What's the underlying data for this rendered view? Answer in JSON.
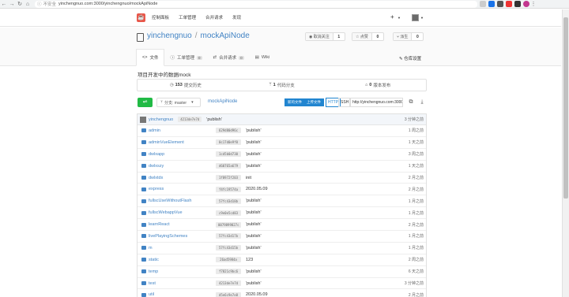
{
  "browser": {
    "insecure_label": "不安全",
    "url": "yinchengnuo.com:3000/yinchengnuo/mockApiNode"
  },
  "topnav": [
    "控制面板",
    "工单管理",
    "合并请求",
    "发现"
  ],
  "repo": {
    "owner": "yinchengnuo",
    "name": "mockApiNode",
    "watch_label": "取消关注",
    "watch_count": "1",
    "star_label": "点赞",
    "star_count": "0",
    "fork_label": "派生",
    "fork_count": "0"
  },
  "tabs": [
    {
      "label": "文件",
      "badge": ""
    },
    {
      "label": "工单管理",
      "badge": "0"
    },
    {
      "label": "合并请求",
      "badge": "0"
    },
    {
      "label": "Wiki",
      "badge": ""
    }
  ],
  "settings_label": "仓库设置",
  "description": "项目开发中的数据mock",
  "stats": {
    "commits_count": "153",
    "commits_label": "提交历史",
    "branches_count": "1",
    "branches_label": "代码分支",
    "releases_count": "0",
    "releases_label": "版本发布"
  },
  "toolbar": {
    "branch_label": "分支: master",
    "path": "mockApiNode",
    "new_file": "新的文件",
    "upload_file": "上传文件",
    "https": "HTTP",
    "ssh": "SSH",
    "clone_url": "http://yinchengnuo.com:3000/yinchengnuo/mockApiNode.git"
  },
  "latest_commit": {
    "author": "yinchengnuo",
    "sha": "4213de7e7d",
    "message": "'publish'",
    "time": "3 分钟之前"
  },
  "files": [
    {
      "name": "admin",
      "sha": "629d80d96c",
      "message": "'publish'",
      "time": "1 周之前"
    },
    {
      "name": "adminVueElement",
      "sha": "0c17d0e9f0",
      "message": "'publish'",
      "time": "1 天之前"
    },
    {
      "name": "dwlxapp",
      "sha": "1cd5b0d730",
      "message": "'publish'",
      "time": "3 周之前"
    },
    {
      "name": "dwlxszy",
      "sha": "d60765a679",
      "message": "'publish'",
      "time": "1 天之前"
    },
    {
      "name": "dwlxtdx",
      "sha": "1f8972f203",
      "message": "init",
      "time": "2 月之前"
    },
    {
      "name": "express",
      "sha": "f4fc19574a",
      "message": "2020.05.09",
      "time": "2 月之前"
    },
    {
      "name": "fullscUseWithoutFlash",
      "sha": "57fc43d18b",
      "message": "'publish'",
      "time": "1 月之前"
    },
    {
      "name": "fullscWebappVue",
      "sha": "c9e0e5cd83",
      "message": "'publish'",
      "time": "1 月之前"
    },
    {
      "name": "learnReact",
      "sha": "0079899827c",
      "message": "'publish'",
      "time": "2 月之前"
    },
    {
      "name": "livePlayingSchemes",
      "sha": "57fc43d17b",
      "message": "'publish'",
      "time": "1 月之前"
    },
    {
      "name": "m",
      "sha": "57fc43d15b",
      "message": "'publish'",
      "time": "1 月之前"
    },
    {
      "name": "static",
      "sha": "26ad5984a",
      "message": "123",
      "time": "2 周之前"
    },
    {
      "name": "temp",
      "sha": "f7821c9bc6",
      "message": "'publish'",
      "time": "6 天之前"
    },
    {
      "name": "test",
      "sha": "4213de7e7d",
      "message": "'publish'",
      "time": "3 分钟之前"
    },
    {
      "name": "util",
      "sha": "d5e6c9e7e8",
      "message": "2020.05.09",
      "time": "2 月之前"
    }
  ]
}
